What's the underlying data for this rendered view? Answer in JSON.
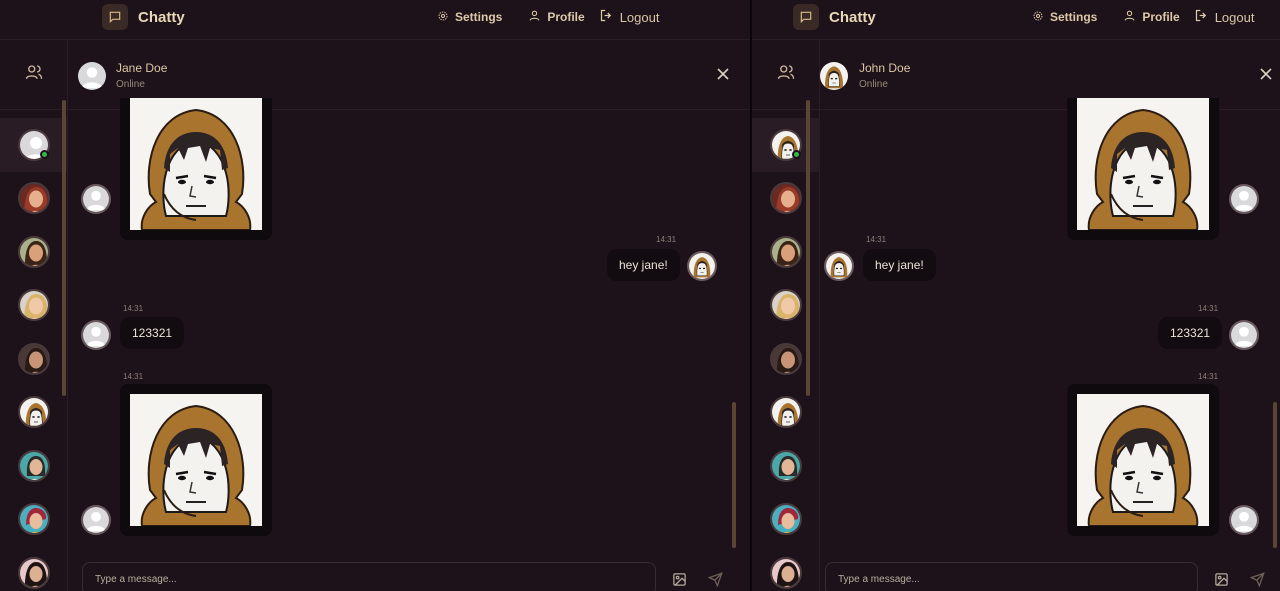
{
  "app": {
    "brand": "Chatty"
  },
  "nav": {
    "settings": "Settings",
    "profile": "Profile",
    "logout": "Logout"
  },
  "colors": {
    "background": "#1d1219",
    "accent": "#dcc9a8",
    "online": "#2fb84e",
    "bubble": "#120b10"
  },
  "left": {
    "header": {
      "name": "Jane Doe",
      "status": "Online"
    },
    "messages": {
      "t1": "14:31",
      "hey": "hey jane!",
      "t2": "14:31",
      "num": "123321",
      "t3": "14:31"
    },
    "input_placeholder": "Type a message..."
  },
  "right": {
    "header": {
      "name": "John Doe",
      "status": "Online"
    },
    "messages": {
      "t1": "14:31",
      "hey": "hey jane!",
      "t2": "14:31",
      "num": "123321",
      "t3": "14:31"
    },
    "input_placeholder": "Type a message..."
  },
  "icons": [
    "chat-icon",
    "gear-icon",
    "user-icon",
    "logout-icon",
    "users-icon",
    "close-icon",
    "image-icon",
    "send-icon"
  ]
}
